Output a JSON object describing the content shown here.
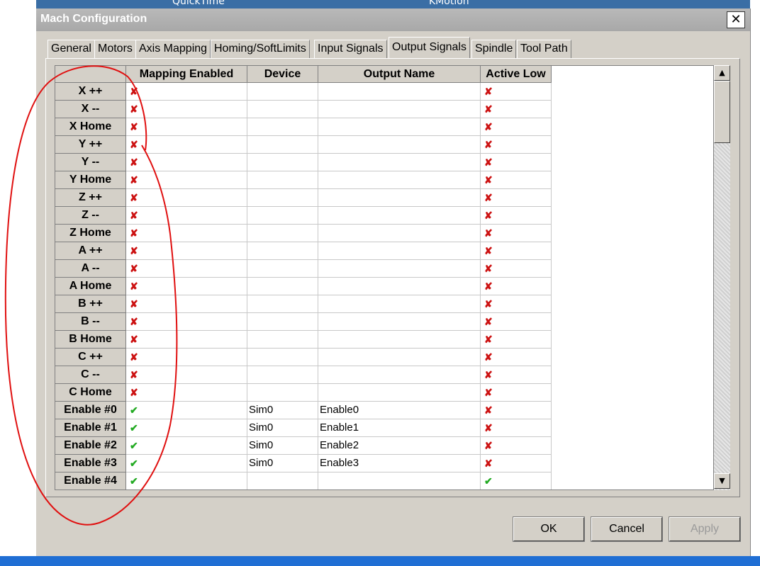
{
  "desktop": {
    "top_label_1": "QuickTime",
    "top_label_2": "KMotion"
  },
  "dialog": {
    "title": "Mach Configuration",
    "close_symbol": "✕"
  },
  "tabs": [
    {
      "label": "General"
    },
    {
      "label": "Motors"
    },
    {
      "label": "Axis Mapping"
    },
    {
      "label": "Homing/SoftLimits"
    },
    {
      "label": "Input Signals"
    },
    {
      "label": "Output Signals"
    },
    {
      "label": "Spindle"
    },
    {
      "label": "Tool Path"
    }
  ],
  "active_tab": "Output Signals",
  "grid": {
    "columns": [
      "Mapping Enabled",
      "Device",
      "Output Name",
      "Active Low"
    ],
    "rows": [
      {
        "name": "X ++",
        "mapping_enabled": false,
        "device": "",
        "output_name": "",
        "active_low": false
      },
      {
        "name": "X --",
        "mapping_enabled": false,
        "device": "",
        "output_name": "",
        "active_low": false
      },
      {
        "name": "X Home",
        "mapping_enabled": false,
        "device": "",
        "output_name": "",
        "active_low": false
      },
      {
        "name": "Y ++",
        "mapping_enabled": false,
        "device": "",
        "output_name": "",
        "active_low": false
      },
      {
        "name": "Y --",
        "mapping_enabled": false,
        "device": "",
        "output_name": "",
        "active_low": false
      },
      {
        "name": "Y Home",
        "mapping_enabled": false,
        "device": "",
        "output_name": "",
        "active_low": false
      },
      {
        "name": "Z ++",
        "mapping_enabled": false,
        "device": "",
        "output_name": "",
        "active_low": false
      },
      {
        "name": "Z --",
        "mapping_enabled": false,
        "device": "",
        "output_name": "",
        "active_low": false
      },
      {
        "name": "Z Home",
        "mapping_enabled": false,
        "device": "",
        "output_name": "",
        "active_low": false
      },
      {
        "name": "A ++",
        "mapping_enabled": false,
        "device": "",
        "output_name": "",
        "active_low": false
      },
      {
        "name": "A --",
        "mapping_enabled": false,
        "device": "",
        "output_name": "",
        "active_low": false
      },
      {
        "name": "A Home",
        "mapping_enabled": false,
        "device": "",
        "output_name": "",
        "active_low": false
      },
      {
        "name": "B ++",
        "mapping_enabled": false,
        "device": "",
        "output_name": "",
        "active_low": false
      },
      {
        "name": "B --",
        "mapping_enabled": false,
        "device": "",
        "output_name": "",
        "active_low": false
      },
      {
        "name": "B Home",
        "mapping_enabled": false,
        "device": "",
        "output_name": "",
        "active_low": false
      },
      {
        "name": "C ++",
        "mapping_enabled": false,
        "device": "",
        "output_name": "",
        "active_low": false
      },
      {
        "name": "C --",
        "mapping_enabled": false,
        "device": "",
        "output_name": "",
        "active_low": false
      },
      {
        "name": "C Home",
        "mapping_enabled": false,
        "device": "",
        "output_name": "",
        "active_low": false
      },
      {
        "name": "Enable #0",
        "mapping_enabled": true,
        "device": "Sim0",
        "output_name": "Enable0",
        "active_low": false
      },
      {
        "name": "Enable #1",
        "mapping_enabled": true,
        "device": "Sim0",
        "output_name": "Enable1",
        "active_low": false
      },
      {
        "name": "Enable #2",
        "mapping_enabled": true,
        "device": "Sim0",
        "output_name": "Enable2",
        "active_low": false
      },
      {
        "name": "Enable #3",
        "mapping_enabled": true,
        "device": "Sim0",
        "output_name": "Enable3",
        "active_low": false
      },
      {
        "name": "Enable #4",
        "mapping_enabled": true,
        "device": "",
        "output_name": "",
        "active_low": true
      }
    ]
  },
  "icons": {
    "checked": "✔",
    "unchecked": "✘",
    "scroll_up": "▲",
    "scroll_down": "▼"
  },
  "colors": {
    "unchecked": "#cc1111",
    "checked": "#22aa22",
    "annotation": "#e01010"
  },
  "buttons": {
    "ok": "OK",
    "cancel": "Cancel",
    "apply": "Apply"
  }
}
